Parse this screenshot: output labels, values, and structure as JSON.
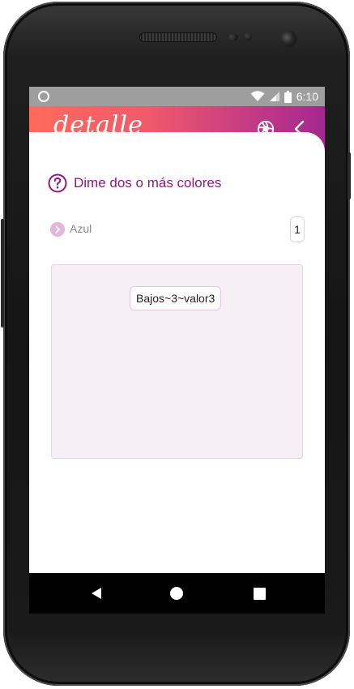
{
  "status_bar": {
    "time": "6:10"
  },
  "app_bar": {
    "title": "detalle",
    "camera_icon": "camera-shutter-icon",
    "back_icon": "chevron-left-icon"
  },
  "question": {
    "icon": "help-circle-icon",
    "text": "Dime dos o más colores"
  },
  "options": [
    {
      "label": "Azul",
      "count": "1"
    }
  ],
  "dropzone": {
    "chips": [
      "Bajos~3~valor3"
    ]
  },
  "nav": {
    "back": "back-triangle-icon",
    "home": "home-circle-icon",
    "recents": "recents-square-icon"
  },
  "colors": {
    "accent": "#8e1a7e",
    "gradient_start": "#ff6a5c",
    "gradient_end": "#a4288f"
  }
}
